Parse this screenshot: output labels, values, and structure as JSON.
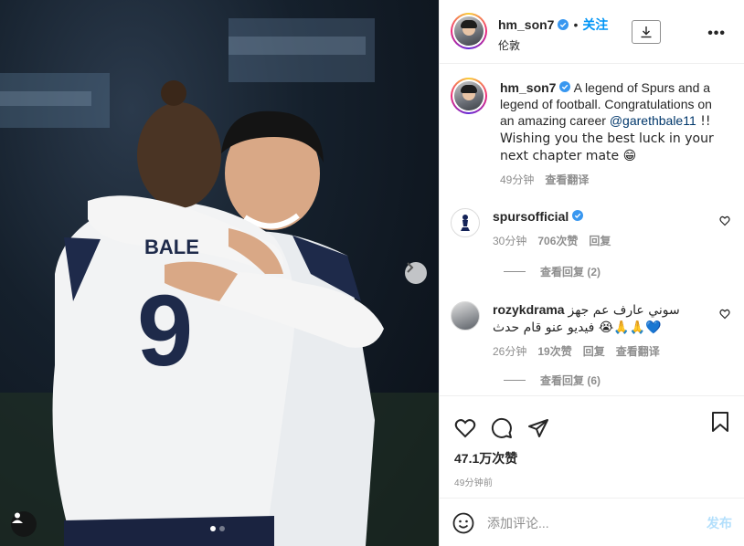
{
  "colors": {
    "accent": "#0095f6",
    "verified": "#3897f0",
    "muted": "#8e8e8e",
    "text": "#262626",
    "post_disabled": "#b2dffc"
  },
  "photo": {
    "alt_icons": [
      "chevron-right-icon",
      "user-tag-icon"
    ],
    "carousel": {
      "count": 2,
      "active": 0
    }
  },
  "header": {
    "username": "hm_son7",
    "separator": "•",
    "follow_label": "关注",
    "location": "伦敦",
    "more_label": "•••"
  },
  "caption": {
    "username": "hm_son7",
    "text_before": "A legend of Spurs and a legend of football. Congratulations on an amazing career ",
    "mention": "@garethbale11",
    "text_after": " !! Wishing you the best luck in your next chapter mate 😁",
    "time": "49分钟",
    "translate_label": "查看翻译"
  },
  "comments": [
    {
      "username": "spursofficial",
      "text": "",
      "time": "30分钟",
      "likes": "706次赞",
      "reply_label": "回复",
      "view_replies": "查看回复 (2)"
    },
    {
      "username": "rozykdrama",
      "text": "سوني عارف عم جهز فيديو عنو قام حدث 😭🙏🙏💙",
      "time": "26分钟",
      "likes": "19次赞",
      "reply_label": "回复",
      "translate_label": "查看翻译",
      "view_replies": "查看回复 (6)"
    }
  ],
  "post": {
    "likes": "47.1万次赞",
    "time_ago": "49分钟前"
  },
  "composer": {
    "placeholder": "添加评论...",
    "post_label": "发布"
  }
}
